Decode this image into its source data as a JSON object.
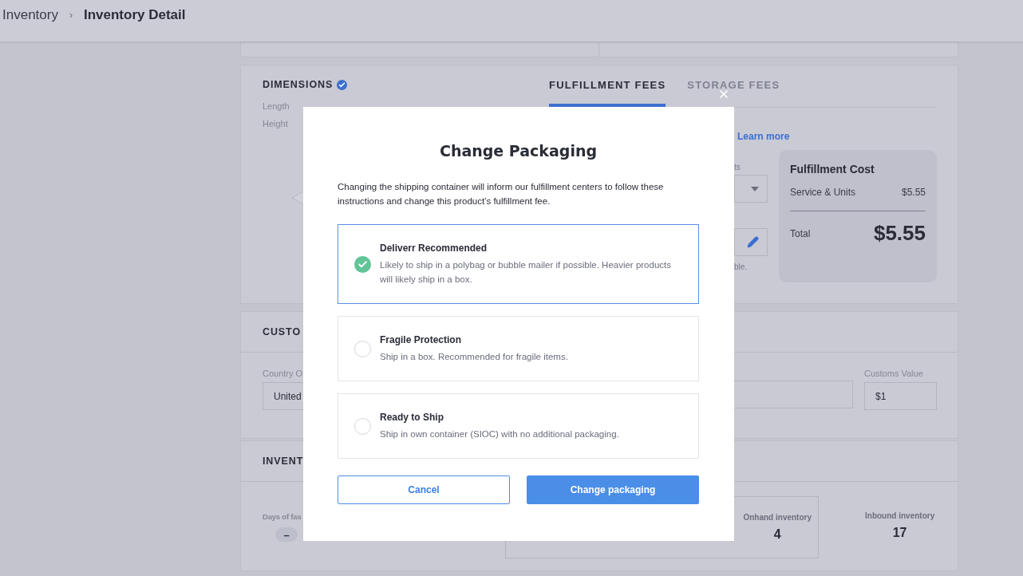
{
  "breadcrumb": {
    "items": [
      "Inventory",
      "Inventory Detail"
    ],
    "separator": "›"
  },
  "dimensions": {
    "title": "DIMENSIONS",
    "verified": true,
    "labels": [
      "Length",
      "Height"
    ]
  },
  "fees": {
    "tabs": [
      {
        "label": "FULFILLMENT FEES",
        "selected": true
      },
      {
        "label": "STORAGE FEES",
        "selected": false
      }
    ],
    "link": "Learn more",
    "field_label": "ts",
    "note": "ble.",
    "cost": {
      "title": "Fulfillment Cost",
      "rows": [
        {
          "label": "Service & Units",
          "value": "$5.55"
        }
      ],
      "total_label": "Total",
      "total_value": "$5.55"
    }
  },
  "customs": {
    "title": "CUSTO",
    "country_label": "Country O",
    "country_value": "United",
    "value_label": "Customs Value",
    "value": "$1"
  },
  "inventory": {
    "title": "INVENT",
    "days_label": "Days of fas",
    "days_value": "–",
    "stats": [
      {
        "label": "Onhand inventory",
        "value": "4"
      },
      {
        "label": "Inbound inventory",
        "value": "17"
      }
    ]
  },
  "modal": {
    "title": "Change Packaging",
    "description": "Changing the shipping container will inform our fulfillment centers to follow these instructions and change this product’s fulfillment fee.",
    "options": [
      {
        "title": "Deliverr Recommended",
        "description": "Likely to ship in a polybag or bubble mailer if possible. Heavier products will likely ship in a box.",
        "selected": true
      },
      {
        "title": "Fragile Protection",
        "description": "Ship in a box. Recommended for fragile items.",
        "selected": false
      },
      {
        "title": "Ready to Ship",
        "description": "Ship in own container (SIOC) with no additional packaging.",
        "selected": false
      }
    ],
    "buttons": [
      {
        "label": "Cancel",
        "kind": "secondary"
      },
      {
        "label": "Change packaging",
        "kind": "primary"
      }
    ]
  }
}
